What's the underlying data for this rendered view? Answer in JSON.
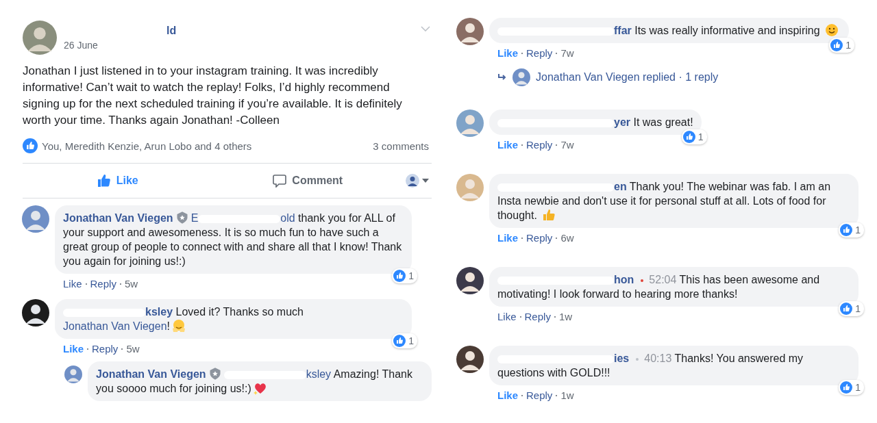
{
  "post": {
    "author_fragment": "ld",
    "date": "26 June",
    "text": "Jonathan I just listened in to your instagram training. It was incredibly informative! Can’t wait to watch the replay! Folks, I’d highly recommend signing up for the next scheduled training if you’re available. It is definitely worth your time. Thanks again Jonathan! -Colleen",
    "reactions": "You, Meredith Kenzie, Arun Lobo and 4 others",
    "comment_count": "3 comments",
    "actions": [
      {
        "kind": "like",
        "label": "Like",
        "selected": true
      },
      {
        "kind": "comment",
        "label": "Comment",
        "selected": false
      }
    ]
  },
  "left_comments": [
    {
      "segments": [
        {
          "kind": "name",
          "text": "Jonathan Van Viegen"
        },
        {
          "kind": "badge"
        },
        {
          "kind": "mention",
          "text": "E"
        },
        {
          "kind": "redacted"
        },
        {
          "kind": "mention",
          "text": "old"
        },
        {
          "kind": "body",
          "text": " thank you for ALL of your support and awesomeness. It is so much fun to have such a great group of people to connect with and share all that I know! Thank you again for joining us!:)"
        }
      ],
      "liked": false,
      "like": "Like",
      "reply": "Reply",
      "time": "5w",
      "reaction_count": "1"
    },
    {
      "segments": [
        {
          "kind": "redacted"
        },
        {
          "kind": "name",
          "text": "ksley"
        },
        {
          "kind": "body",
          "text": " Loved it? Thanks so much "
        },
        {
          "kind": "mention",
          "text": "Jonathan Van Viegen"
        },
        {
          "kind": "body",
          "text": "!"
        },
        {
          "kind": "hug"
        }
      ],
      "liked": true,
      "like": "Like",
      "reply": "Reply",
      "time": "5w",
      "reaction_count": "1",
      "replies": [
        {
          "segments": [
            {
              "kind": "name",
              "text": "Jonathan Van Viegen"
            },
            {
              "kind": "badge"
            },
            {
              "kind": "redacted"
            },
            {
              "kind": "mention",
              "text": "ksley"
            },
            {
              "kind": "body",
              "text": " Amazing! Thank you soooo much for joining us!:)"
            },
            {
              "kind": "heart"
            }
          ]
        }
      ]
    }
  ],
  "right_comments": [
    {
      "segments": [
        {
          "kind": "redacted"
        },
        {
          "kind": "name",
          "text": "ffar"
        },
        {
          "kind": "body",
          "text": " Its was really informative and inspiring "
        },
        {
          "kind": "smile"
        }
      ],
      "liked": true,
      "like": "Like",
      "reply": "Reply",
      "time": "7w",
      "reaction_count": "1",
      "replied": "Jonathan Van Viegen replied · 1 reply"
    },
    {
      "segments": [
        {
          "kind": "redacted"
        },
        {
          "kind": "name",
          "text": "yer"
        },
        {
          "kind": "body",
          "text": " It was great!"
        }
      ],
      "liked": true,
      "like": "Like",
      "reply": "Reply",
      "time": "7w",
      "reaction_count": "1"
    },
    {
      "segments": [
        {
          "kind": "redacted"
        },
        {
          "kind": "name",
          "text": "en"
        },
        {
          "kind": "body",
          "text": " Thank you! The webinar was fab. I am an Insta newbie and don't use it for personal stuff at all. Lots of food for thought. "
        },
        {
          "kind": "thumb"
        }
      ],
      "liked": true,
      "like": "Like",
      "reply": "Reply",
      "time": "6w",
      "reaction_count": "1"
    },
    {
      "segments": [
        {
          "kind": "redacted"
        },
        {
          "kind": "name",
          "text": "hon"
        },
        {
          "kind": "timestamp",
          "text": "52:04",
          "color": "#e0453a"
        },
        {
          "kind": "body",
          "text": " This has been awesome and motivating! I look forward to hearing more thanks!"
        }
      ],
      "liked": false,
      "like": "Like",
      "reply": "Reply",
      "time": "1w",
      "reaction_count": "1"
    },
    {
      "segments": [
        {
          "kind": "redacted"
        },
        {
          "kind": "name",
          "text": "ies"
        },
        {
          "kind": "timestamp",
          "text": "40:13",
          "color": "#bec3c9"
        },
        {
          "kind": "body",
          "text": " Thanks! You answered my questions with GOLD!!!"
        }
      ],
      "liked": true,
      "like": "Like",
      "reply": "Reply",
      "time": "1w",
      "reaction_count": "1"
    }
  ]
}
